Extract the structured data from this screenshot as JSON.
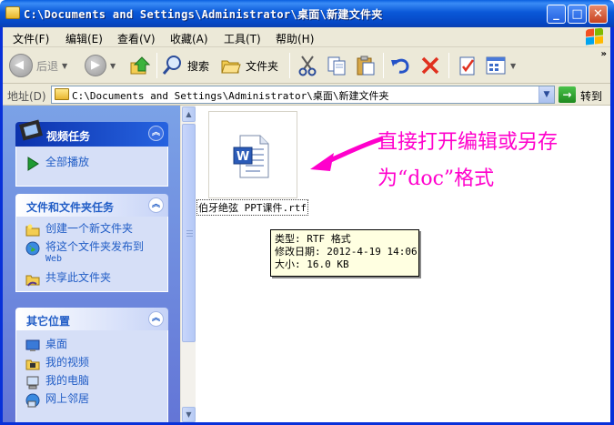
{
  "window": {
    "title": "C:\\Documents and Settings\\Administrator\\桌面\\新建文件夹",
    "minimize": "_",
    "maximize": "□",
    "close": "✕"
  },
  "menu": {
    "items": [
      "文件(F)",
      "编辑(E)",
      "查看(V)",
      "收藏(A)",
      "工具(T)",
      "帮助(H)"
    ]
  },
  "toolbar": {
    "back_label": "后退",
    "search_label": "搜索",
    "folders_label": "文件夹",
    "more": "»"
  },
  "address": {
    "label": "地址(D)",
    "value": "C:\\Documents and Settings\\Administrator\\桌面\\新建文件夹",
    "go_label": "转到"
  },
  "tasks": {
    "video": {
      "title": "视频任务",
      "items": [
        {
          "label": "全部播放"
        }
      ]
    },
    "file_folder": {
      "title": "文件和文件夹任务",
      "items": [
        {
          "label": "创建一个新文件夹"
        },
        {
          "label": "将这个文件夹发布到",
          "sub": "Web"
        },
        {
          "label": "共享此文件夹"
        }
      ]
    },
    "other_places": {
      "title": "其它位置",
      "items": [
        {
          "label": "桌面"
        },
        {
          "label": "我的视频"
        },
        {
          "label": "我的电脑"
        },
        {
          "label": "网上邻居"
        }
      ]
    }
  },
  "file": {
    "name": "伯牙绝弦 PPT课件.rtf"
  },
  "tooltip": {
    "type": "类型: RTF 格式",
    "modified": "修改日期: 2012-4-19 14:06",
    "size": "大小: 16.0 KB"
  },
  "annotation": {
    "line1": "直接打开编辑或另存",
    "line2": "为“doc”格式",
    "color": "#ff00cc"
  }
}
